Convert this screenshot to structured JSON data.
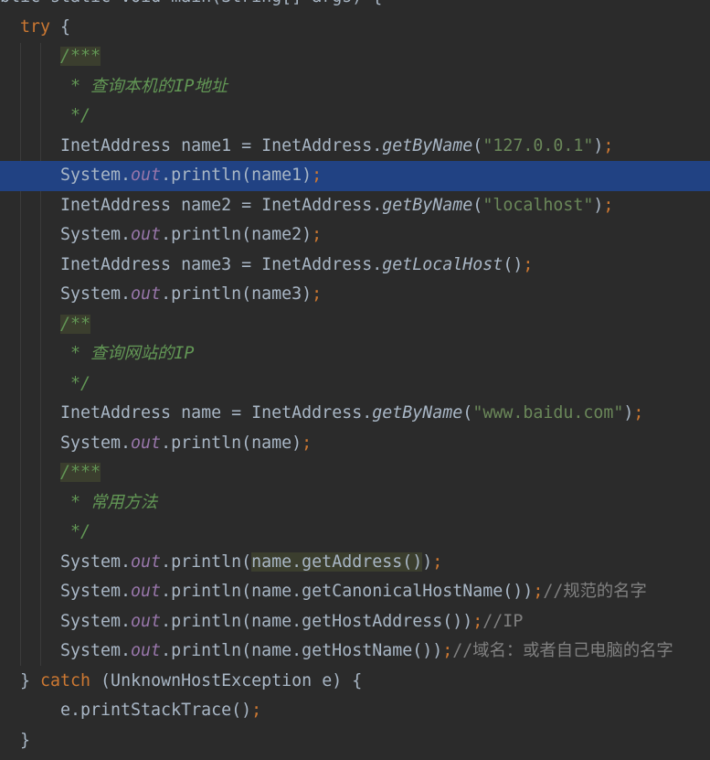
{
  "editor": {
    "lines": [
      {
        "type": "header",
        "text": "blic static void main(String[] args) {"
      },
      {
        "type": "try",
        "kw": "try",
        "rest": " {"
      },
      {
        "type": "doc-open",
        "text": "/***"
      },
      {
        "type": "doc",
        "text": " * 查询本机的IP地址"
      },
      {
        "type": "doc",
        "text": " */"
      },
      {
        "type": "decl",
        "cls": "InetAddress",
        "var": " name1 = ",
        "cls2": "InetAddress",
        "dot": ".",
        "method": "getByName",
        "open": "(",
        "str": "\"127.0.0.1\"",
        "close": ")",
        "semi": ";"
      },
      {
        "type": "println",
        "sys": "System.",
        "out": "out",
        "call": ".println(name1)",
        "semi": ";"
      },
      {
        "type": "decl",
        "cls": "InetAddress",
        "var": " name2 = ",
        "cls2": "InetAddress",
        "dot": ".",
        "method": "getByName",
        "open": "(",
        "str": "\"localhost\"",
        "close": ")",
        "semi": ";"
      },
      {
        "type": "println",
        "sys": "System.",
        "out": "out",
        "call": ".println(name2)",
        "semi": ";"
      },
      {
        "type": "decl2",
        "cls": "InetAddress",
        "var": " name3 = ",
        "cls2": "InetAddress",
        "dot": ".",
        "method": "getLocalHost",
        "close": "()",
        "semi": ";"
      },
      {
        "type": "println",
        "sys": "System.",
        "out": "out",
        "call": ".println(name3)",
        "semi": ";"
      },
      {
        "type": "doc-open",
        "text": "/**"
      },
      {
        "type": "doc",
        "text": " * 查询网站的IP"
      },
      {
        "type": "doc",
        "text": " */"
      },
      {
        "type": "decl",
        "cls": "InetAddress",
        "var": " name = ",
        "cls2": "InetAddress",
        "dot": ".",
        "method": "getByName",
        "open": "(",
        "str": "\"www.baidu.com\"",
        "close": ")",
        "semi": ";"
      },
      {
        "type": "println",
        "sys": "System.",
        "out": "out",
        "call": ".println(name)",
        "semi": ";"
      },
      {
        "type": "doc-open",
        "text": "/***"
      },
      {
        "type": "doc",
        "text": " * 常用方法"
      },
      {
        "type": "doc",
        "text": " */"
      },
      {
        "type": "println-hl",
        "sys": "System.",
        "out": "out",
        "pre": ".println(",
        "hl": "name.getAddress()",
        "post": ")",
        "semi": ";"
      },
      {
        "type": "println-cmt",
        "sys": "System.",
        "out": "out",
        "call": ".println(name.getCanonicalHostName())",
        "semi": ";",
        "cmt": "//规范的名字"
      },
      {
        "type": "println-cmt",
        "sys": "System.",
        "out": "out",
        "call": ".println(name.getHostAddress())",
        "semi": ";",
        "cmt": "//IP"
      },
      {
        "type": "println-cmt",
        "sys": "System.",
        "out": "out",
        "call": ".println(name.getHostName())",
        "semi": ";",
        "cmt": "//域名：或者自己电脑的名字"
      },
      {
        "type": "catch",
        "pre": "} ",
        "kw": "catch",
        "rest": " (UnknownHostException e) {"
      },
      {
        "type": "plain-semi",
        "text": "e.printStackTrace()",
        "semi": ";"
      },
      {
        "type": "plain",
        "text": "}"
      }
    ]
  }
}
